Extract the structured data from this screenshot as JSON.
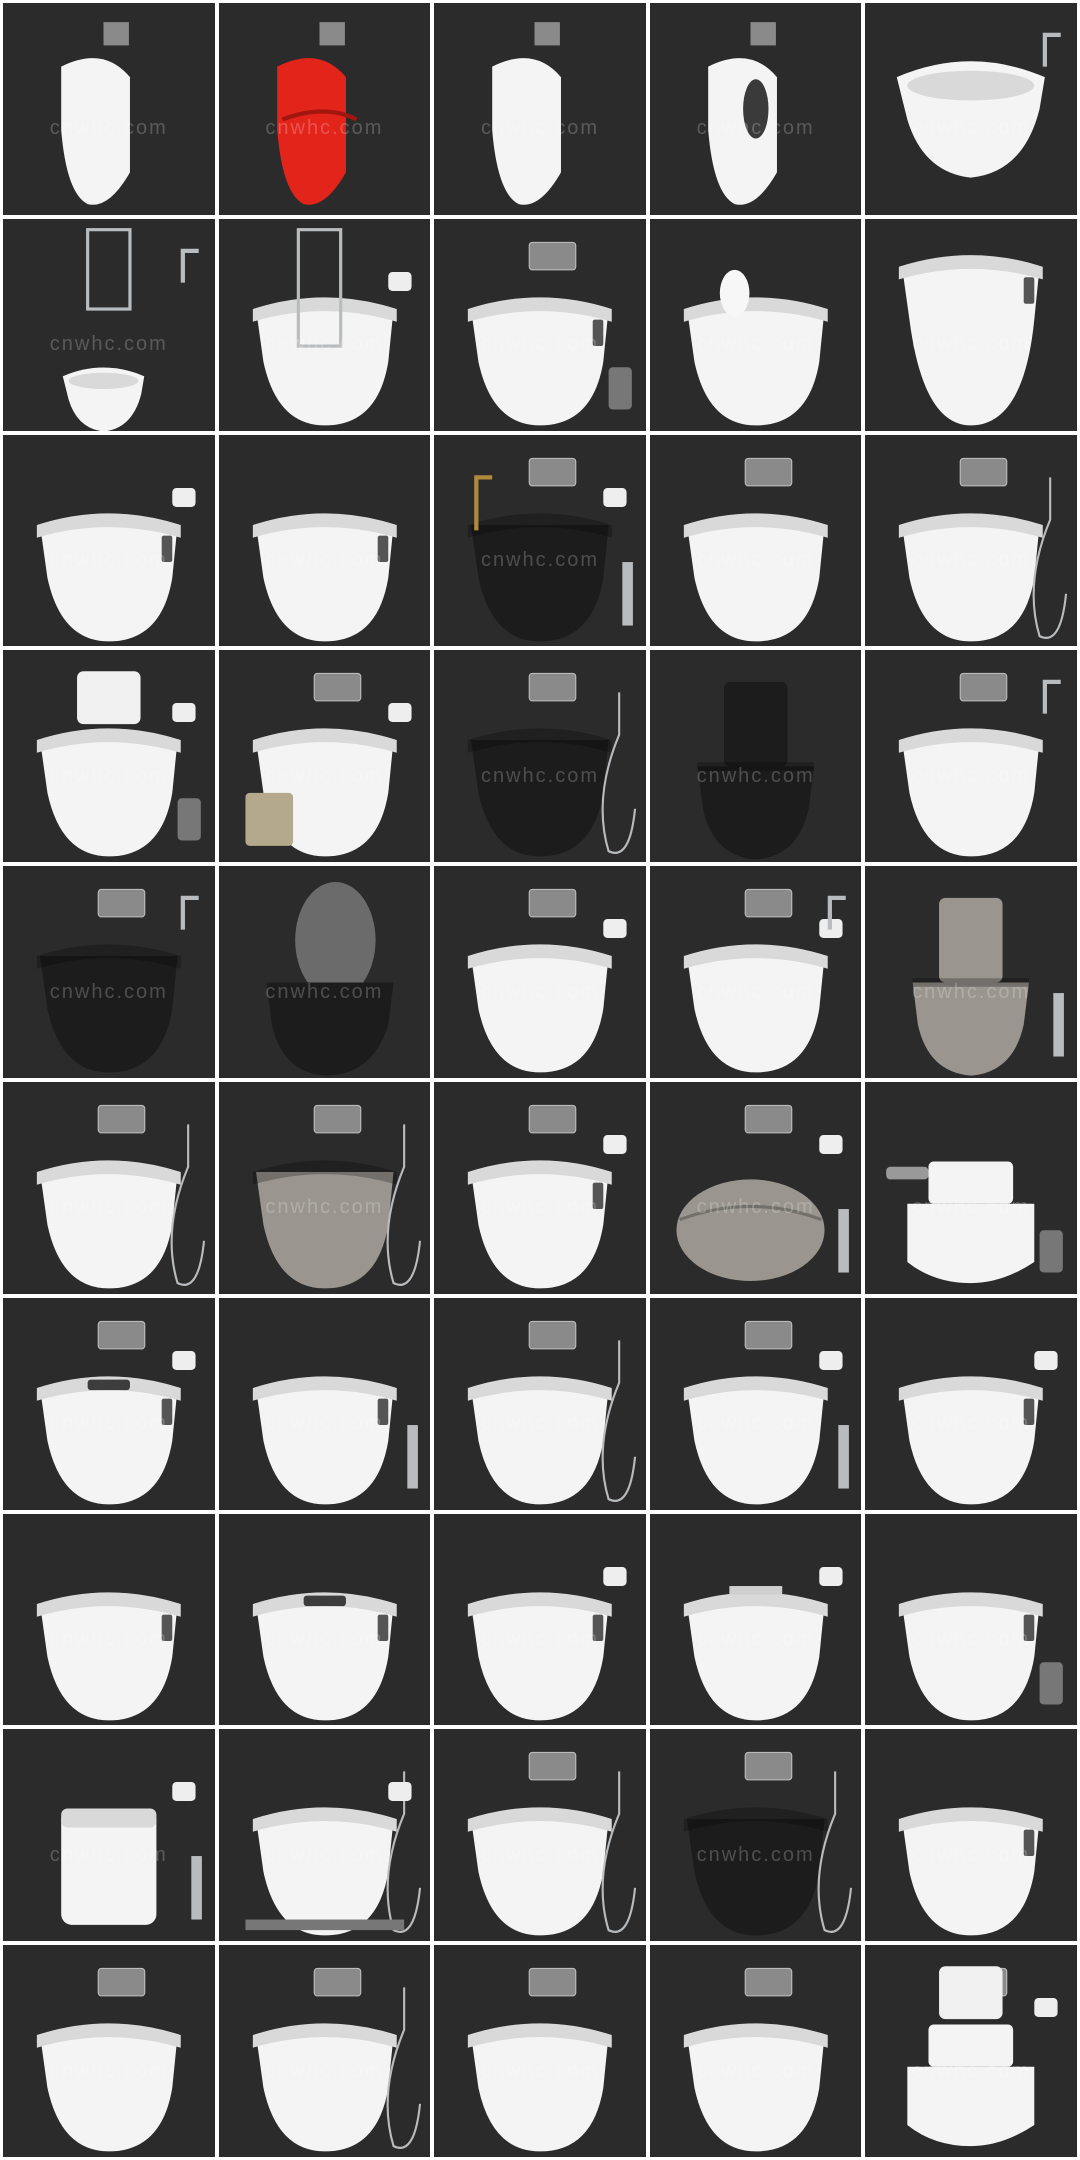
{
  "watermark": "cnwhc.com",
  "colors": {
    "background": "#2b2b2b",
    "porcelain": "#f4f4f4",
    "porcelain_shade": "#d9d9d9",
    "black_porcelain": "#1c1c1c",
    "grey_porcelain": "#9a968f",
    "red_urinal": "#e3241b",
    "chrome": "#b9bcbf",
    "flush_plate": "#8a8a8a"
  },
  "tiles": [
    {
      "kind": "urinal",
      "color": "white",
      "accessories": [
        "sensor-plate"
      ]
    },
    {
      "kind": "urinal-lips",
      "color": "red",
      "accessories": [
        "sensor-plate"
      ]
    },
    {
      "kind": "urinal",
      "color": "white",
      "accessories": [
        "sensor-plate"
      ]
    },
    {
      "kind": "urinal-open",
      "color": "white",
      "accessories": [
        "sensor-plate"
      ]
    },
    {
      "kind": "bidet",
      "color": "white",
      "accessories": [
        "faucet"
      ]
    },
    {
      "kind": "bidet-small",
      "color": "white",
      "accessories": [
        "towel-rail",
        "faucet"
      ]
    },
    {
      "kind": "toilet-small",
      "color": "white",
      "accessories": [
        "shelf-rack",
        "roll-holder"
      ]
    },
    {
      "kind": "smart-toilet",
      "color": "white",
      "accessories": [
        "flush-plate",
        "bin"
      ]
    },
    {
      "kind": "toilet-figurine",
      "color": "white",
      "accessories": [
        "rabbit-figurine"
      ]
    },
    {
      "kind": "smart-toilet-tall",
      "color": "white",
      "accessories": []
    },
    {
      "kind": "smart-toilet",
      "color": "white",
      "accessories": [
        "roll-holder"
      ]
    },
    {
      "kind": "smart-toilet",
      "color": "white",
      "accessories": []
    },
    {
      "kind": "wall-toilet",
      "color": "black",
      "accessories": [
        "brass-faucet",
        "flush-plate",
        "roll-holder",
        "brush"
      ]
    },
    {
      "kind": "wall-toilet",
      "color": "white",
      "accessories": [
        "flush-plate"
      ]
    },
    {
      "kind": "wall-toilet",
      "color": "white",
      "accessories": [
        "flush-plate",
        "hand-spray"
      ]
    },
    {
      "kind": "toilet-cabinet",
      "color": "white",
      "accessories": [
        "bottles",
        "roll-holder",
        "bin"
      ]
    },
    {
      "kind": "wall-toilet-rounded",
      "color": "white",
      "accessories": [
        "basket",
        "roll-holder",
        "flush-plate"
      ]
    },
    {
      "kind": "wall-toilet",
      "color": "black",
      "accessories": [
        "flush-plate",
        "hand-spray"
      ]
    },
    {
      "kind": "tank-toilet",
      "color": "black",
      "accessories": []
    },
    {
      "kind": "wall-toilet",
      "color": "white",
      "accessories": [
        "flush-plate",
        "faucet"
      ]
    },
    {
      "kind": "wall-toilet",
      "color": "black",
      "accessories": [
        "flush-plate",
        "faucet"
      ]
    },
    {
      "kind": "toilet-lid-open",
      "color": "black",
      "accessories": []
    },
    {
      "kind": "wall-toilet",
      "color": "white",
      "accessories": [
        "flush-plate",
        "roll-holder"
      ]
    },
    {
      "kind": "wall-toilet",
      "color": "white",
      "accessories": [
        "flush-plate",
        "roll-holder",
        "faucet"
      ]
    },
    {
      "kind": "tank-toilet",
      "color": "grey",
      "accessories": [
        "brush"
      ]
    },
    {
      "kind": "wall-toilet",
      "color": "white",
      "accessories": [
        "flush-plate",
        "hand-spray"
      ]
    },
    {
      "kind": "wall-toilet-rounded",
      "color": "grey",
      "accessories": [
        "flush-plate",
        "hand-spray"
      ]
    },
    {
      "kind": "smart-toilet",
      "color": "white",
      "accessories": [
        "flush-plate",
        "roll-holder"
      ]
    },
    {
      "kind": "egg-toilet",
      "color": "grey",
      "accessories": [
        "flush-plate",
        "roll-holder",
        "brush"
      ]
    },
    {
      "kind": "one-piece-toilet",
      "color": "white",
      "accessories": [
        "towels",
        "bin"
      ]
    },
    {
      "kind": "smart-toilet-display",
      "color": "white",
      "accessories": [
        "roll-holder",
        "flush-plate"
      ]
    },
    {
      "kind": "smart-toilet",
      "color": "white",
      "accessories": [
        "brush"
      ]
    },
    {
      "kind": "wall-toilet",
      "color": "white",
      "accessories": [
        "flush-plate",
        "hand-spray"
      ]
    },
    {
      "kind": "wall-toilet",
      "color": "white",
      "accessories": [
        "flush-plate",
        "roll-holder",
        "brush"
      ]
    },
    {
      "kind": "smart-toilet",
      "color": "white",
      "accessories": [
        "roll-holder"
      ]
    },
    {
      "kind": "smart-toilet",
      "color": "white",
      "accessories": []
    },
    {
      "kind": "smart-toilet-display",
      "color": "white",
      "accessories": []
    },
    {
      "kind": "smart-toilet",
      "color": "white",
      "accessories": [
        "roll-holder"
      ]
    },
    {
      "kind": "wall-toilet",
      "color": "white",
      "accessories": [
        "roll-holder",
        "tray"
      ]
    },
    {
      "kind": "smart-toilet",
      "color": "white",
      "accessories": [
        "bin"
      ]
    },
    {
      "kind": "square-toilet",
      "color": "white",
      "accessories": [
        "brush",
        "roll-holder"
      ]
    },
    {
      "kind": "wall-toilet-small",
      "color": "white",
      "accessories": [
        "hand-spray",
        "roll-holder",
        "mat"
      ]
    },
    {
      "kind": "wall-toilet",
      "color": "white",
      "accessories": [
        "flush-plate",
        "hand-spray"
      ]
    },
    {
      "kind": "wall-toilet-rounded",
      "color": "black",
      "accessories": [
        "flush-plate",
        "hand-spray"
      ]
    },
    {
      "kind": "smart-toilet",
      "color": "white",
      "accessories": []
    },
    {
      "kind": "wall-toilet-rounded",
      "color": "white",
      "accessories": [
        "flush-plate"
      ]
    },
    {
      "kind": "wall-toilet",
      "color": "white",
      "accessories": [
        "flush-plate",
        "hand-spray"
      ]
    },
    {
      "kind": "wall-toilet",
      "color": "white",
      "accessories": [
        "flush-plate"
      ]
    },
    {
      "kind": "wall-toilet",
      "color": "white",
      "accessories": [
        "flush-plate"
      ]
    },
    {
      "kind": "toilet-pedestal",
      "color": "white",
      "accessories": [
        "flush-plate",
        "roll-holder",
        "bottles"
      ]
    }
  ]
}
